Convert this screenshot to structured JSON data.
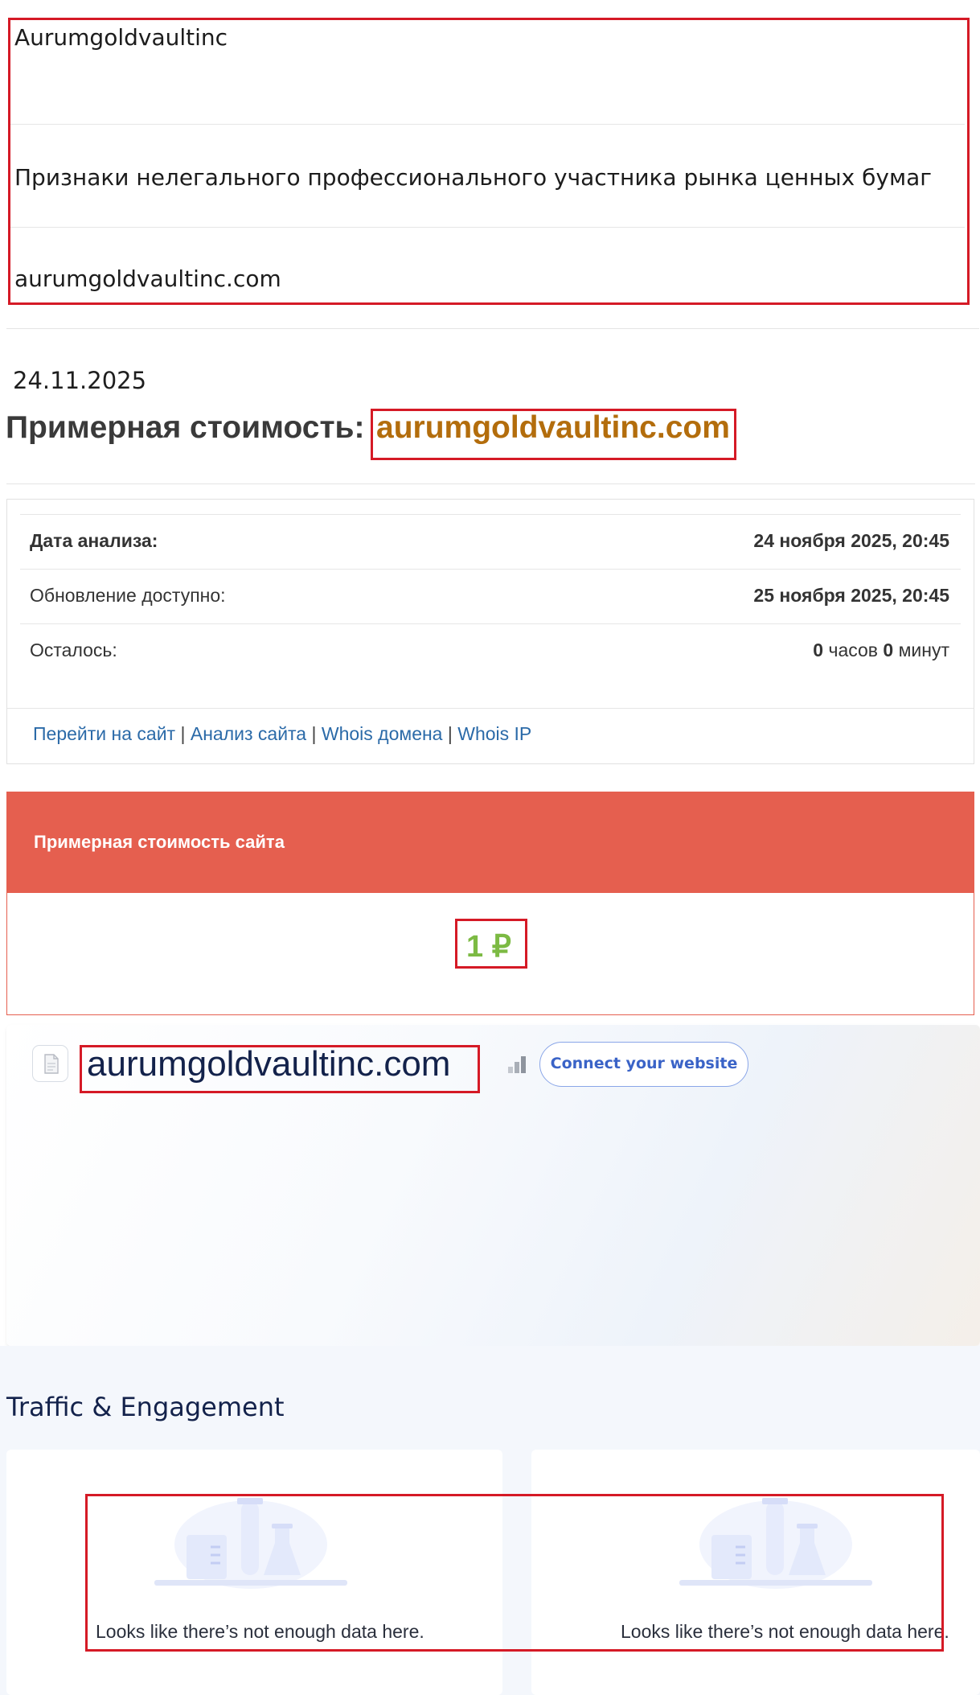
{
  "top": {
    "name": "Aurumgoldvaultinc",
    "warning": "Признаки нелегального профессионального участника рынка ценных бумаг",
    "domain": "aurumgoldvaultinc.com"
  },
  "estimate": {
    "date": "24.11.2025",
    "title_prefix": "Примерная стоимость:",
    "title_domain": "aurumgoldvaultinc.com"
  },
  "info": {
    "rows": [
      {
        "label": "Дата анализа:",
        "value": "24 ноября 2025, 20:45"
      },
      {
        "label": "Обновление доступно:",
        "value": "25 ноября 2025, 20:45"
      },
      {
        "label": "Осталось:",
        "hours": "0",
        "hours_unit": "часов",
        "minutes": "0",
        "minutes_unit": "минут"
      }
    ],
    "links": [
      "Перейти на сайт",
      "Анализ сайта",
      "Whois домена",
      "Whois IP"
    ],
    "link_separator": "|"
  },
  "cost": {
    "header": "Примерная стоимость сайта",
    "value": "1 ₽"
  },
  "site": {
    "domain": "aurumgoldvaultinc.com",
    "connect_label": "Connect your website",
    "favicon_icon": "document-icon",
    "rank_icon": "bar-chart-icon"
  },
  "traffic": {
    "title": "Traffic & Engagement",
    "empty_text_left": "Looks like there’s not enough data here.",
    "empty_text_right": "Looks like there’s not enough data here."
  },
  "colors": {
    "highlight_box": "#d51a26",
    "domain_accent": "#b36d0c",
    "cost_header": "#e55f4f",
    "cost_value": "#7cba43",
    "link": "#2b6aa8",
    "navy": "#13224b"
  }
}
